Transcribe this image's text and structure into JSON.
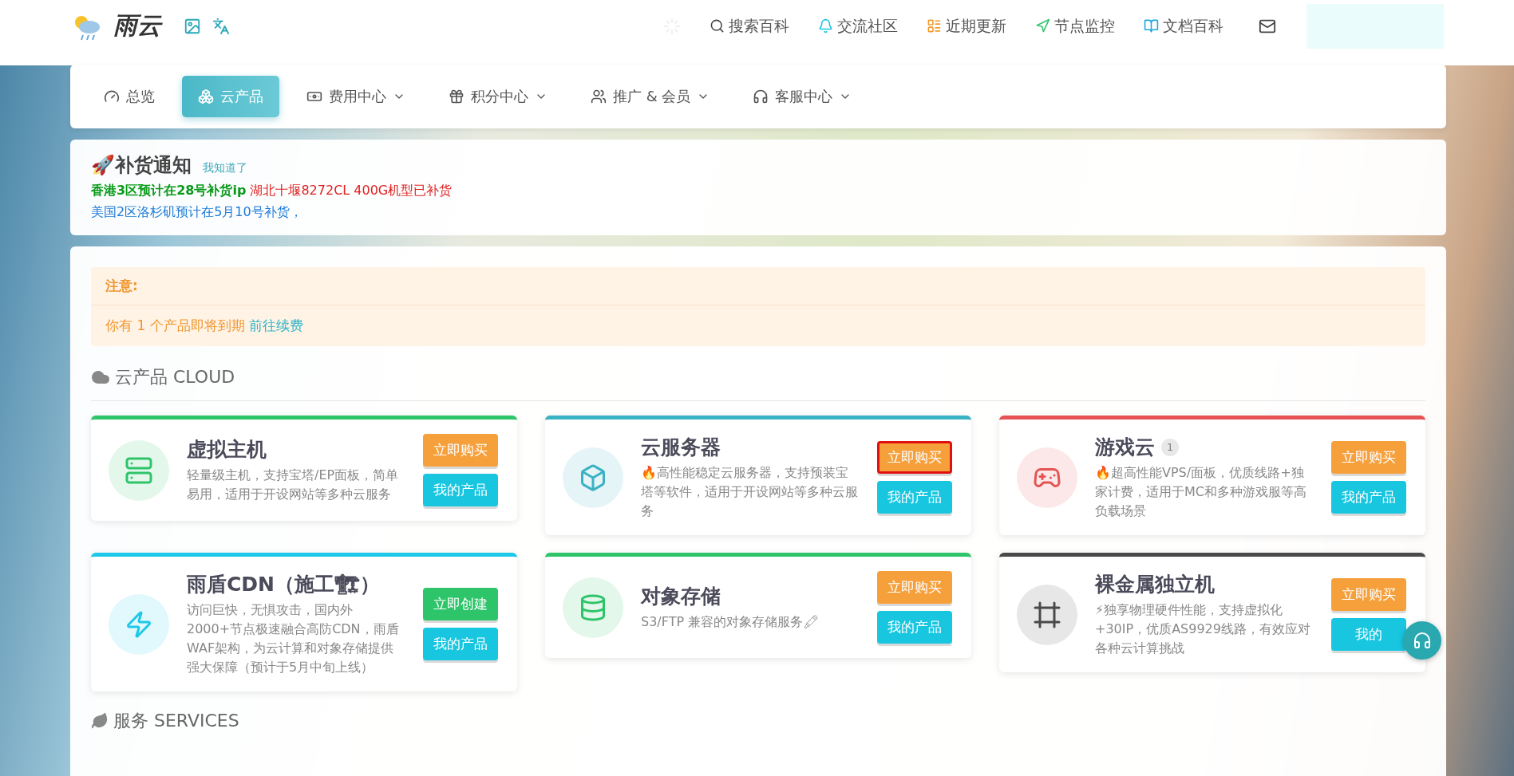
{
  "header": {
    "brand": "雨云",
    "links": [
      {
        "label": "搜索百科"
      },
      {
        "label": "交流社区"
      },
      {
        "label": "近期更新"
      },
      {
        "label": "节点监控"
      },
      {
        "label": "文档百科"
      }
    ]
  },
  "nav": {
    "tabs": [
      {
        "label": "总览",
        "selected": false,
        "dropdown": false
      },
      {
        "label": "云产品",
        "selected": true,
        "dropdown": false
      },
      {
        "label": "费用中心",
        "selected": false,
        "dropdown": true
      },
      {
        "label": "积分中心",
        "selected": false,
        "dropdown": true
      },
      {
        "label": "推广 & 会员",
        "selected": false,
        "dropdown": true
      },
      {
        "label": "客服中心",
        "selected": false,
        "dropdown": true
      }
    ]
  },
  "notice": {
    "title": "🚀补货通知",
    "dismiss": "我知道了",
    "lines": [
      [
        {
          "text": "香港3区预计在28号补货ip",
          "color": "#0a9a1a",
          "bold": true
        },
        {
          "text": " 湖北十堰8272CL 400G机型已补货",
          "color": "#e02020",
          "bold": false
        }
      ],
      [
        {
          "text": "美国2区洛杉矶预计在5月10号补货，",
          "color": "#1a7ad8",
          "bold": false
        }
      ]
    ]
  },
  "alert": {
    "title": "注意:",
    "message": "你有 1 个产品即将到期",
    "link": "前往续费"
  },
  "cloud_section": {
    "title": "云产品 CLOUD",
    "products": [
      {
        "name": "虚拟主机",
        "color": "#2ec46a",
        "description": "轻量级主机，支持宝塔/EP面板，简单易用，适用于开设网站等多种云服务",
        "buttons": [
          {
            "label": "立即购买",
            "kind": "buy",
            "highlighted": false
          },
          {
            "label": "我的产品",
            "kind": "mine",
            "highlighted": false
          }
        ]
      },
      {
        "name": "云服务器",
        "color": "#3bb2c4",
        "description": "🔥高性能稳定云服务器，支持预装宝塔等软件，适用于开设网站等多种云服务",
        "buttons": [
          {
            "label": "立即购买",
            "kind": "buy",
            "highlighted": true
          },
          {
            "label": "我的产品",
            "kind": "mine",
            "highlighted": false
          }
        ]
      },
      {
        "name": "游戏云",
        "color": "#e55353",
        "badge": "1",
        "description": "🔥超高性能VPS/面板，优质线路+独家计费，适用于MC和多种游戏服等高负载场景",
        "buttons": [
          {
            "label": "立即购买",
            "kind": "buy",
            "highlighted": false
          },
          {
            "label": "我的产品",
            "kind": "mine",
            "highlighted": false
          }
        ]
      },
      {
        "name": "雨盾CDN（施工🏗）",
        "color": "#1ec8e8",
        "description": "访问巨快，无惧攻击，国内外2000+节点极速融合高防CDN，雨盾WAF架构，为云计算和对象存储提供强大保障（预计于5月中旬上线）",
        "buttons": [
          {
            "label": "立即创建",
            "kind": "create",
            "highlighted": false
          },
          {
            "label": "我的产品",
            "kind": "mine",
            "highlighted": false
          }
        ]
      },
      {
        "name": "对象存储",
        "color": "#2ec46a",
        "description": "S3/FTP 兼容的对象存储服务🖍",
        "buttons": [
          {
            "label": "立即购买",
            "kind": "buy",
            "highlighted": false
          },
          {
            "label": "我的产品",
            "kind": "mine",
            "highlighted": false
          }
        ]
      },
      {
        "name": "裸金属独立机",
        "color": "#4a4a4a",
        "description": "⚡独享物理硬件性能，支持虚拟化+30IP，优质AS9929线路，有效应对各种云计算挑战",
        "buttons": [
          {
            "label": "立即购买",
            "kind": "buy",
            "highlighted": false
          },
          {
            "label": "我的",
            "kind": "mine",
            "highlighted": false
          }
        ]
      }
    ]
  },
  "services_section": {
    "title": "服务 SERVICES"
  }
}
